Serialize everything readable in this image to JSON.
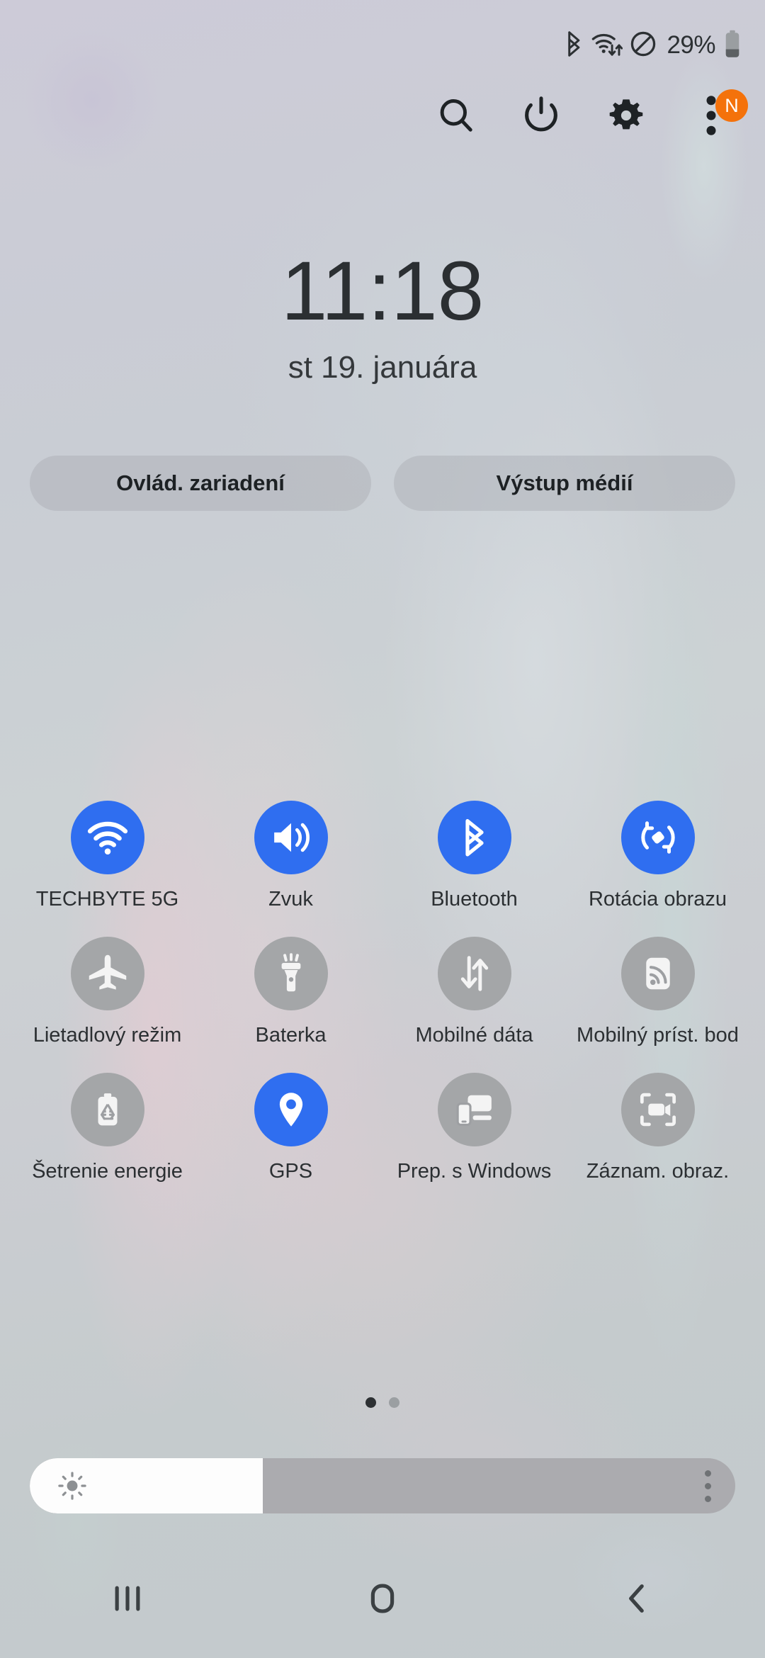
{
  "status_bar": {
    "icons": [
      "bluetooth-icon",
      "wifi-data-icon",
      "do-not-disturb-icon"
    ],
    "battery_percent": "29%",
    "battery_icon": "battery-low-icon"
  },
  "header": {
    "search_label": "search-icon",
    "power_label": "power-icon",
    "settings_label": "gear-icon",
    "menu_label": "more-options-icon",
    "menu_badge": "N",
    "badge_color": "#f4720b"
  },
  "clock": {
    "time": "11:18",
    "date": "st 19. januára"
  },
  "pills": [
    {
      "label": "Ovlád. zariadení"
    },
    {
      "label": "Výstup médií"
    }
  ],
  "quick_settings": {
    "active_color": "#2f6ef0",
    "inactive_color": "#a4a6a8",
    "tiles": [
      {
        "label": "TECHBYTE 5G",
        "icon": "wifi-icon",
        "state": "on"
      },
      {
        "label": "Zvuk",
        "icon": "sound-icon",
        "state": "on"
      },
      {
        "label": "Bluetooth",
        "icon": "bluetooth-icon",
        "state": "on"
      },
      {
        "label": "Rotácia obrazu",
        "icon": "auto-rotate-icon",
        "state": "on"
      },
      {
        "label": "Lietadlový režim",
        "icon": "airplane-icon",
        "state": "off"
      },
      {
        "label": "Baterka",
        "icon": "flashlight-icon",
        "state": "off"
      },
      {
        "label": "Mobilné dáta",
        "icon": "mobile-data-icon",
        "state": "off"
      },
      {
        "label": "Mobilný príst. bod",
        "icon": "hotspot-icon",
        "state": "off"
      },
      {
        "label": "Šetrenie energie",
        "icon": "power-saving-icon",
        "state": "off"
      },
      {
        "label": "GPS",
        "icon": "location-pin-icon",
        "state": "on"
      },
      {
        "label": "Prep. s Windows",
        "icon": "link-to-windows-icon",
        "state": "off"
      },
      {
        "label": "Záznam. obraz.",
        "icon": "screen-recorder-icon",
        "state": "off"
      }
    ]
  },
  "page_indicator": {
    "total": 2,
    "current": 1
  },
  "brightness": {
    "value_percent": 33,
    "sun_icon": "brightness-sun-icon",
    "menu_icon": "more-options-icon"
  },
  "nav_bar": {
    "recents": "recents-icon",
    "home": "home-icon",
    "back": "back-icon"
  }
}
